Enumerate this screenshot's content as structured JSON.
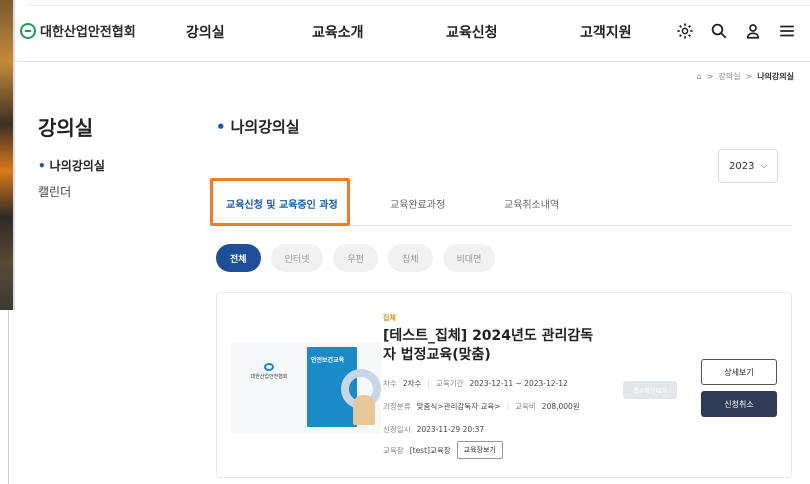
{
  "header": {
    "logo_text": "대한산업안전협회",
    "nav": [
      "강의실",
      "교육소개",
      "교육신청",
      "고객지원"
    ],
    "icons": [
      "gear-icon",
      "search-icon",
      "user-icon",
      "menu-icon"
    ]
  },
  "breadcrumb": {
    "home_icon": "⌂",
    "sep": ">",
    "items": [
      "강의실",
      "나의강의실"
    ]
  },
  "sidebar": {
    "title": "강의실",
    "items": [
      {
        "label": "나의강의실",
        "active": true
      },
      {
        "label": "캘린더",
        "active": false
      }
    ]
  },
  "main": {
    "title": "나의강의실",
    "year_select": {
      "value": "2023"
    },
    "tabs": [
      "교육신청 및 교육중인 과정",
      "교육완료과정",
      "교육취소내역"
    ],
    "chips": [
      "전체",
      "인터넷",
      "우편",
      "집체",
      "비대면"
    ]
  },
  "course": {
    "category": "집체",
    "title": "[테스트_집체] 2024년도 관리감독자 법정교육(맞춤)",
    "book_cover_title": "안전보건교육",
    "book_logo": "대한산업안전협회",
    "round_label": "차수",
    "round_value": "2차수",
    "period_label": "교육기간",
    "period_value": "2023-12-11 ~ 2023-12-12",
    "course_type_label": "과정분류",
    "course_type_value": "맞춤식>관리감독자 교육>",
    "fee_label": "교육비",
    "fee_value": "208,000원",
    "applied_label": "신청일시",
    "applied_value": "2023-11-29 20:37",
    "venue_label": "교육장",
    "venue_value": "[test]교육장",
    "venue_button": "교육장보기",
    "status": "접수확인대기",
    "detail_button": "상세보기",
    "cancel_button": "신청취소"
  },
  "colors": {
    "accent": "#1a5ba6",
    "highlight": "#ef7d26",
    "chip_active": "#1f4f99",
    "cancel_bg": "#2f3b55"
  }
}
